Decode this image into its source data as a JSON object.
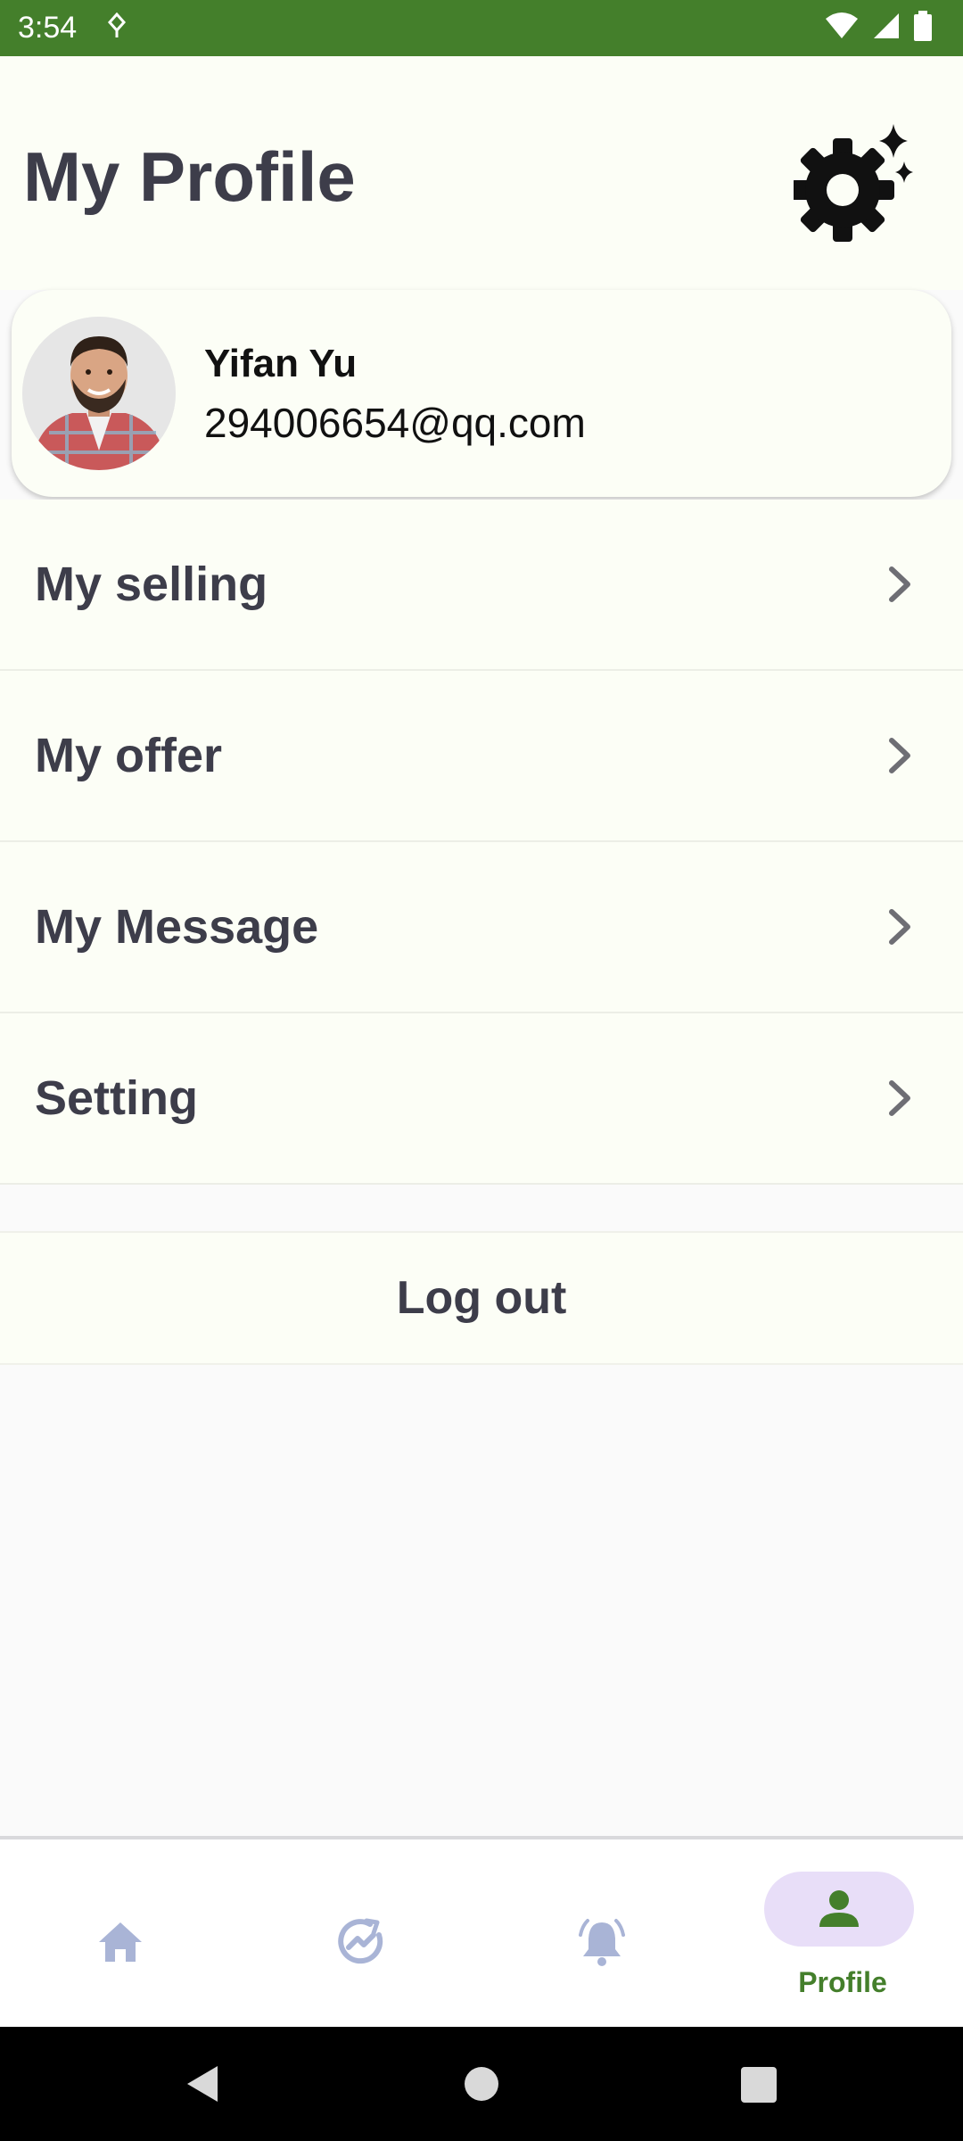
{
  "status_bar": {
    "time": "3:54"
  },
  "header": {
    "title": "My Profile",
    "settings_icon": "settings-sparkle-icon"
  },
  "profile": {
    "name": "Yifan Yu",
    "email": "294006654@qq.com"
  },
  "menu": {
    "items": [
      {
        "label": "My selling"
      },
      {
        "label": "My offer"
      },
      {
        "label": "My Message"
      },
      {
        "label": "Setting"
      }
    ]
  },
  "logout": {
    "label": "Log out"
  },
  "bottom_nav": {
    "items": [
      {
        "icon": "home-icon",
        "label": ""
      },
      {
        "icon": "trending-icon",
        "label": ""
      },
      {
        "icon": "bell-icon",
        "label": ""
      },
      {
        "icon": "person-icon",
        "label": "Profile",
        "active": true
      }
    ]
  },
  "colors": {
    "brand_green": "#447f2b",
    "active_pill": "#e8def8",
    "inactive_icon": "#a9b4d6",
    "text_dark": "#3d3d4a"
  }
}
